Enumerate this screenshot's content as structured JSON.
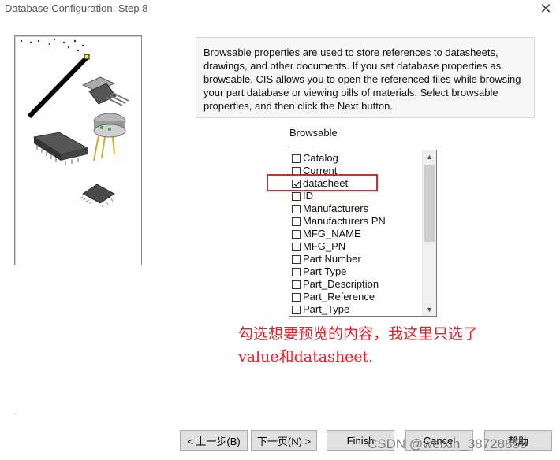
{
  "window": {
    "title": "Database Configuration: Step 8",
    "close_glyph": "✕"
  },
  "description": "Browsable properties are used to store references to datasheets, drawings, and other documents. If you set database properties as browsable, CIS allows you to open the referenced files while browsing your part database or viewing bills of materials. Select browsable properties, and then click the Next button.",
  "browsable": {
    "label": "Browsable",
    "items": [
      {
        "label": "Catalog",
        "checked": false
      },
      {
        "label": "Current",
        "checked": false
      },
      {
        "label": "datasheet",
        "checked": true
      },
      {
        "label": "ID",
        "checked": false
      },
      {
        "label": "Manufacturers",
        "checked": false
      },
      {
        "label": "Manufacturers PN",
        "checked": false
      },
      {
        "label": "MFG_NAME",
        "checked": false
      },
      {
        "label": "MFG_PN",
        "checked": false
      },
      {
        "label": "Part Number",
        "checked": false
      },
      {
        "label": "Part Type",
        "checked": false
      },
      {
        "label": "Part_Description",
        "checked": false
      },
      {
        "label": "Part_Reference",
        "checked": false
      },
      {
        "label": "Part_Type",
        "checked": false
      }
    ]
  },
  "annotation": {
    "line1": "勾选想要预览的内容，我这里只选了",
    "line2": "value和datasheet."
  },
  "buttons": {
    "back": "< 上一步(B)",
    "next": "下一页(N) >",
    "finish": "Finish",
    "cancel": "Cancel",
    "help": "帮助"
  },
  "watermark": "CSDN @weixin_38728859",
  "colors": {
    "annotation_red": "#e8202a",
    "button_face": "#e1e1e1"
  }
}
